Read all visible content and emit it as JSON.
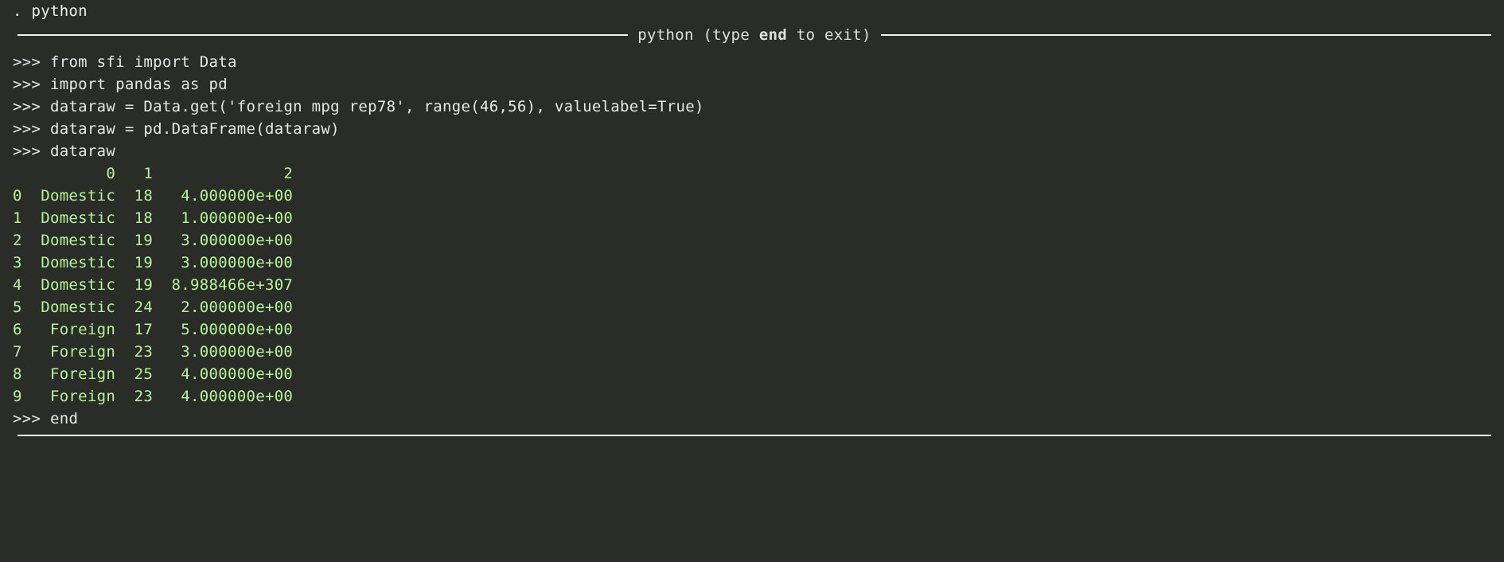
{
  "command_line": ". python",
  "banner": {
    "prefix": "python (type ",
    "bold": "end",
    "suffix": " to exit)"
  },
  "prompt": ">>> ",
  "inputs": [
    "from sfi import Data",
    "import pandas as pd",
    "dataraw = Data.get('foreign mpg rep78', range(46,56), valuelabel=True)",
    "dataraw = pd.DataFrame(dataraw)",
    "dataraw"
  ],
  "df": {
    "header": "          0   1              2",
    "rows": [
      "0  Domestic  18   4.000000e+00",
      "1  Domestic  18   1.000000e+00",
      "2  Domestic  19   3.000000e+00",
      "3  Domestic  19   3.000000e+00",
      "4  Domestic  19  8.988466e+307",
      "5  Domestic  24   2.000000e+00",
      "6   Foreign  17   5.000000e+00",
      "7   Foreign  23   3.000000e+00",
      "8   Foreign  25   4.000000e+00",
      "9   Foreign  23   4.000000e+00"
    ]
  },
  "end_input": "end"
}
